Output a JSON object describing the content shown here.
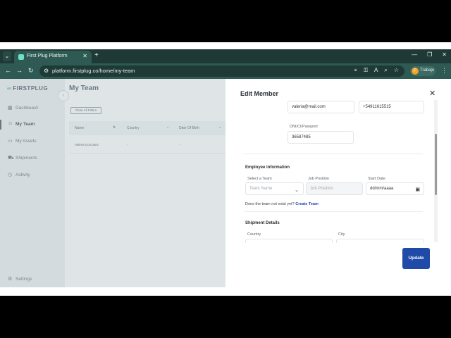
{
  "browser": {
    "tab_title": "First Plug Platform",
    "url": "platform.firstplug.co/home/my-team",
    "profile_initial": "F",
    "profile_name": "Trabajo"
  },
  "app": {
    "logo": "FIRSTPLUG",
    "page_title": "My Team",
    "clear_filters": "Clear All Filters",
    "nav": [
      {
        "label": "Dashboard",
        "icon": "dashboard-icon"
      },
      {
        "label": "My Team",
        "icon": "team-icon"
      },
      {
        "label": "My Assets",
        "icon": "assets-icon"
      },
      {
        "label": "Shipments",
        "icon": "shipments-icon"
      },
      {
        "label": "Activity",
        "icon": "activity-icon"
      }
    ],
    "settings_label": "Settings",
    "table": {
      "headers": [
        "Name",
        "Country",
        "Date Of Birth"
      ],
      "rows": [
        [
          "Valeria Gonzalez",
          "-",
          "-"
        ]
      ]
    }
  },
  "drawer": {
    "title": "Edit Member",
    "email_value": "valeria@mail.com",
    "phone_value": "+54911615515",
    "dni_label": "DNI/CI/Passport",
    "dni_value": "36587485",
    "employee_section": "Employee information",
    "team_label": "Select a Team",
    "team_placeholder": "Team Name",
    "job_label": "Job Position",
    "job_placeholder": "Job Position",
    "start_label": "Start Date",
    "start_placeholder": "dd/mm/aaaa",
    "no_team_text": "Does the team not exist yet?",
    "create_team": "Create Team",
    "shipment_section": "Shipment Details",
    "country_label": "Country",
    "city_label": "City",
    "update_button": "Update"
  },
  "colors": {
    "primary": "#1f4aa8",
    "chrome_dark": "#1f3a36",
    "chrome": "#2f5a54",
    "overlay": "rgba(170,185,190,0.38)"
  }
}
